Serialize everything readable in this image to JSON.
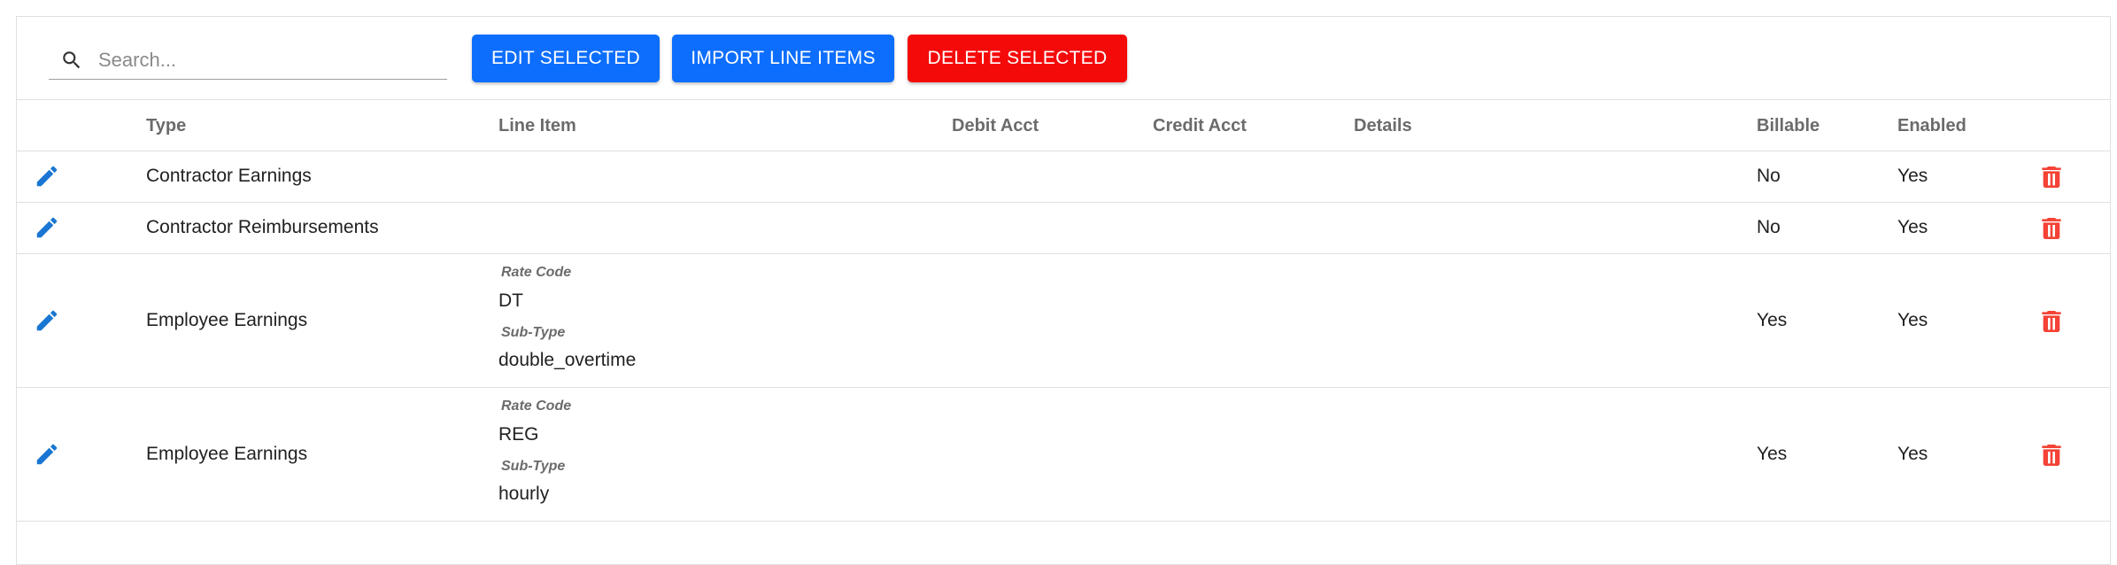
{
  "search": {
    "placeholder": "Search...",
    "value": ""
  },
  "toolbar": {
    "edit_label": "EDIT SELECTED",
    "import_label": "IMPORT LINE ITEMS",
    "delete_label": "DELETE SELECTED"
  },
  "columns": {
    "type": "Type",
    "line_item": "Line Item",
    "debit_acct": "Debit Acct",
    "credit_acct": "Credit Acct",
    "details": "Details",
    "billable": "Billable",
    "enabled": "Enabled"
  },
  "rows": [
    {
      "type": "Contractor Earnings",
      "billable": "No",
      "enabled": "Yes"
    },
    {
      "type": "Contractor Reimbursements",
      "billable": "No",
      "enabled": "Yes"
    },
    {
      "type": "Employee Earnings",
      "rate_code_label": "Rate Code",
      "rate_code": "DT",
      "sub_type_label": "Sub-Type",
      "sub_type": "double_overtime",
      "billable": "Yes",
      "enabled": "Yes"
    },
    {
      "type": "Employee Earnings",
      "rate_code_label": "Rate Code",
      "rate_code": "REG",
      "sub_type_label": "Sub-Type",
      "sub_type": "hourly",
      "billable": "Yes",
      "enabled": "Yes"
    }
  ],
  "icons": {
    "search": "search-icon",
    "edit": "pencil-icon",
    "delete": "trash-icon"
  },
  "colors": {
    "primary": "#0d6efd",
    "danger_button": "#f50a0a",
    "delete_icon": "#f44336",
    "edit_icon": "#1976d2"
  }
}
